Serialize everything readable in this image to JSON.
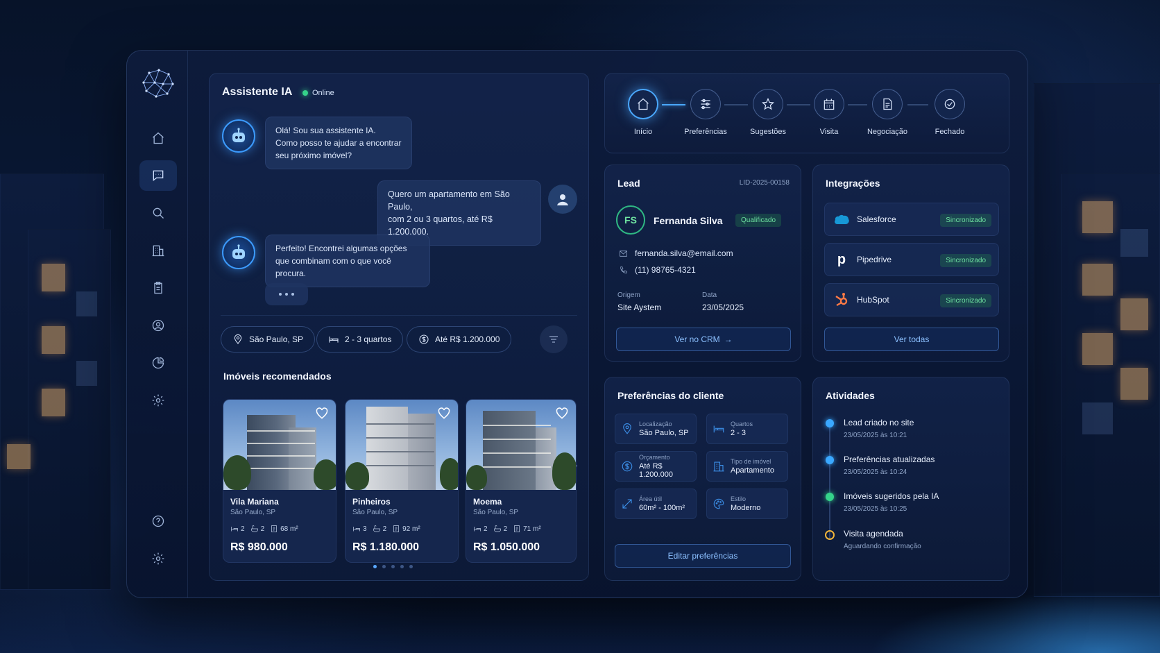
{
  "chat": {
    "title": "Assistente IA",
    "status": "Online",
    "messages": [
      {
        "from": "bot",
        "text": "Olá! Sou sua assistente IA.\nComo posso te ajudar a encontrar\nseu próximo imóvel?"
      },
      {
        "from": "user",
        "text": "Quero um apartamento em São Paulo,\ncom 2 ou 3 quartos, até R$ 1.200.000."
      },
      {
        "from": "bot",
        "text": "Perfeito! Encontrei algumas opções\nque combinam com o que você procura."
      }
    ],
    "chips": [
      "São Paulo, SP",
      "2 - 3 quartos",
      "Até R$ 1.200.000"
    ]
  },
  "recommended": {
    "title": "Imóveis recomendados",
    "cards": [
      {
        "name": "Vila Mariana",
        "city": "São Paulo, SP",
        "bedrooms": "2",
        "baths": "2",
        "area": "68 m²",
        "price": "R$ 980.000"
      },
      {
        "name": "Pinheiros",
        "city": "São Paulo, SP",
        "bedrooms": "3",
        "baths": "2",
        "area": "92 m²",
        "price": "R$ 1.180.000"
      },
      {
        "name": "Moema",
        "city": "São Paulo, SP",
        "bedrooms": "2",
        "baths": "2",
        "area": "71 m²",
        "price": "R$ 1.050.000"
      }
    ],
    "page_count": 5,
    "current_page": 1
  },
  "pipeline": {
    "steps": [
      "Início",
      "Preferências",
      "Sugestões",
      "Visita",
      "Negociação",
      "Fechado"
    ],
    "active": 0
  },
  "lead": {
    "title": "Lead",
    "id": "LID-2025-00158",
    "initials": "FS",
    "name": "Fernanda Silva",
    "status": "Qualificado",
    "email": "fernanda.silva@email.com",
    "phone": "(11) 98765-4321",
    "origin_label": "Origem",
    "origin": "Site Aystem",
    "date_label": "Data",
    "date": "23/05/2025",
    "crm_button": "Ver no CRM"
  },
  "integrations": {
    "title": "Integrações",
    "items": [
      {
        "name": "Salesforce",
        "status": "Sincronizado"
      },
      {
        "name": "Pipedrive",
        "status": "Sincronizado"
      },
      {
        "name": "HubSpot",
        "status": "Sincronizado"
      }
    ],
    "view_all": "Ver todas"
  },
  "preferences": {
    "title": "Preferências do cliente",
    "items": [
      {
        "label": "Localização",
        "value": "São Paulo, SP"
      },
      {
        "label": "Quartos",
        "value": "2 - 3"
      },
      {
        "label": "Orçamento",
        "value": "Até R$ 1.200.000"
      },
      {
        "label": "Tipo de imóvel",
        "value": "Apartamento"
      },
      {
        "label": "Área útil",
        "value": "60m² - 100m²"
      },
      {
        "label": "Estilo",
        "value": "Moderno"
      }
    ],
    "edit_button": "Editar preferências"
  },
  "activities": {
    "title": "Atividades",
    "items": [
      {
        "title": "Lead criado no site",
        "sub": "23/05/2025 às 10:21",
        "color": "#3aa8ff"
      },
      {
        "title": "Preferências atualizadas",
        "sub": "23/05/2025 às 10:24",
        "color": "#3aa8ff"
      },
      {
        "title": "Imóveis sugeridos pela IA",
        "sub": "23/05/2025 às 10:25",
        "color": "#35d38a"
      },
      {
        "title": "Visita agendada",
        "sub": "Aguardando confirmação",
        "color": "#f0b43a"
      }
    ]
  },
  "colors": {
    "accent": "#4aa8ff",
    "success": "#35d38a",
    "warning": "#f0b43a"
  },
  "icons": {
    "sidebar": [
      "home-icon",
      "chat-icon",
      "search-icon",
      "building-icon",
      "clipboard-icon",
      "user-icon",
      "pie-chart-icon",
      "gear-icon"
    ],
    "sidebar_bottom": [
      "help-icon",
      "gear-icon"
    ]
  }
}
